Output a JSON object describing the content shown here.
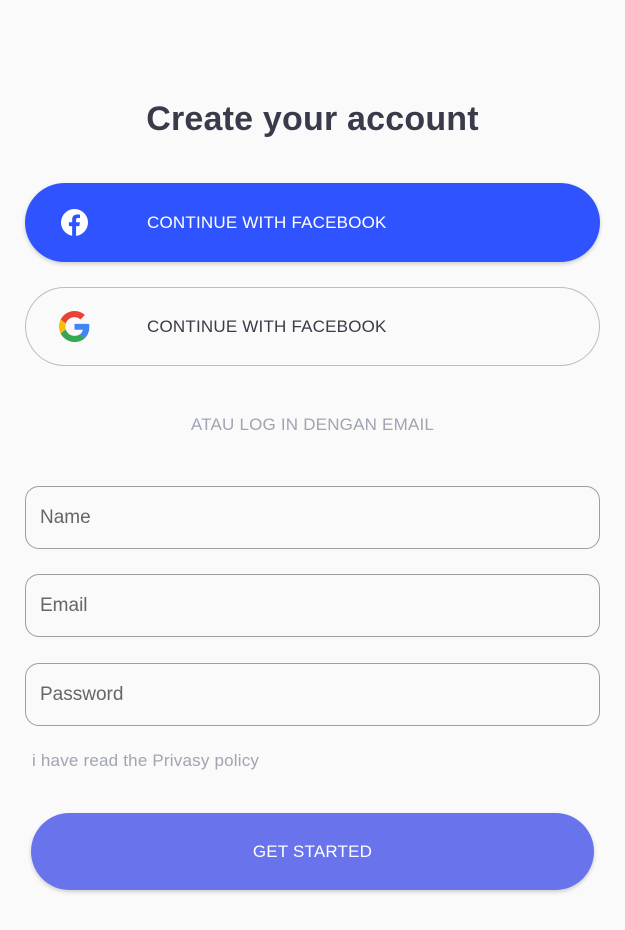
{
  "title": "Create your account",
  "facebook_button": {
    "label": "CONTINUE WITH FACEBOOK",
    "icon": "facebook-icon",
    "color": "#2f54ff"
  },
  "google_button": {
    "label": "CONTINUE WITH FACEBOOK",
    "icon": "google-icon"
  },
  "divider_text": "ATAU LOG IN DENGAN EMAIL",
  "form": {
    "name_placeholder": "Name",
    "email_placeholder": "Email",
    "password_placeholder": "Password"
  },
  "privacy_text": "i have read the Privasy policy",
  "start_button": {
    "label": "GET STARTED",
    "color": "#6973eb"
  }
}
